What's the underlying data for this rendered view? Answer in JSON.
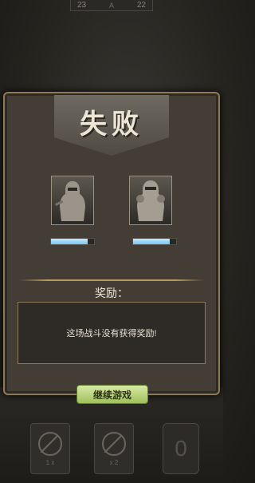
{
  "topbar": {
    "left_value": "23",
    "mid_value": "A",
    "right_value": "22"
  },
  "result": {
    "title": "失败"
  },
  "players": [
    {
      "name": "player-left",
      "hp_fraction": 0.85
    },
    {
      "name": "player-right",
      "hp_fraction": 0.85
    }
  ],
  "rewards": {
    "title": "奖励：",
    "message": "这场战斗没有获得奖励!"
  },
  "buttons": {
    "continue_label": "继续游戏"
  },
  "slots": [
    {
      "label": "1 x"
    },
    {
      "label": "x 2"
    },
    {
      "label": "0"
    }
  ],
  "colors": {
    "panel_border": "#8f7a55",
    "hp_fill": "#79c5f0",
    "continue_button": "#9fc15b"
  }
}
